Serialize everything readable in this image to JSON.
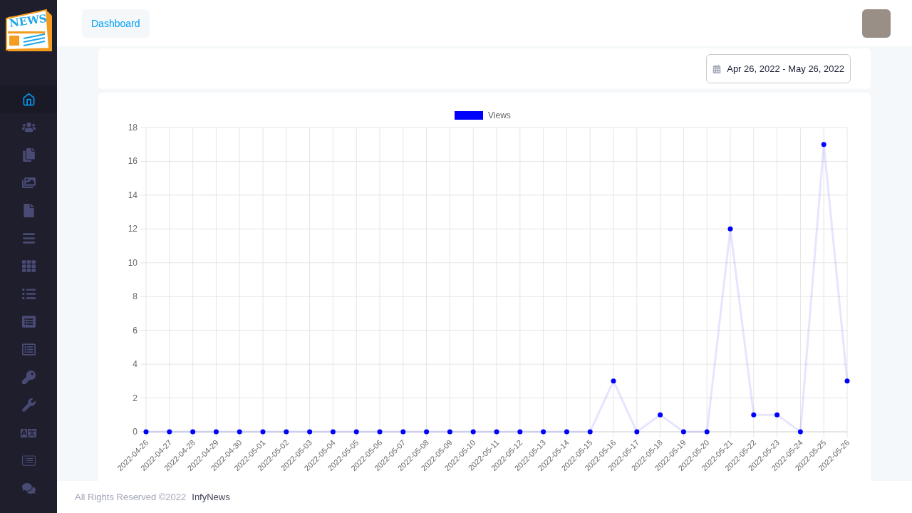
{
  "logo": {
    "text": "NEWS"
  },
  "sidebar": {
    "items": [
      {
        "selected": true
      },
      {
        "selected": false
      },
      {
        "selected": false
      },
      {
        "selected": false
      },
      {
        "selected": false
      },
      {
        "selected": false
      },
      {
        "selected": false
      },
      {
        "selected": false
      },
      {
        "selected": false
      },
      {
        "selected": false
      },
      {
        "selected": false
      },
      {
        "selected": false
      },
      {
        "selected": false,
        "glyphs": [
          "A",
          "文"
        ]
      },
      {
        "selected": false
      },
      {
        "selected": false
      }
    ]
  },
  "header": {
    "breadcrumb": "Dashboard"
  },
  "date_range": "Apr 26, 2022 - May 26, 2022",
  "chart": {
    "chart_data": {
      "type": "line",
      "categories": [
        "2022-04-26",
        "2022-04-27",
        "2022-04-28",
        "2022-04-29",
        "2022-04-30",
        "2022-05-01",
        "2022-05-02",
        "2022-05-03",
        "2022-05-04",
        "2022-05-05",
        "2022-05-06",
        "2022-05-07",
        "2022-05-08",
        "2022-05-09",
        "2022-05-10",
        "2022-05-11",
        "2022-05-12",
        "2022-05-13",
        "2022-05-14",
        "2022-05-15",
        "2022-05-16",
        "2022-05-17",
        "2022-05-18",
        "2022-05-19",
        "2022-05-20",
        "2022-05-21",
        "2022-05-22",
        "2022-05-23",
        "2022-05-24",
        "2022-05-25",
        "2022-05-26"
      ],
      "series": [
        {
          "name": "Views",
          "color": "#0000ff",
          "marker": true,
          "values": [
            0,
            0,
            0,
            0,
            0,
            0,
            0,
            0,
            0,
            0,
            0,
            0,
            0,
            0,
            0,
            0,
            0,
            0,
            0,
            0,
            3,
            0,
            1,
            0,
            0,
            12,
            1,
            1,
            0,
            17,
            3
          ]
        }
      ],
      "ylim": [
        0,
        18
      ],
      "grid": true,
      "yticks": [
        0,
        2,
        4,
        6,
        8,
        10,
        12,
        14,
        16,
        18
      ]
    }
  },
  "footer": {
    "copyright": "All Rights Reserved ©2022",
    "brand": "InfyNews"
  }
}
